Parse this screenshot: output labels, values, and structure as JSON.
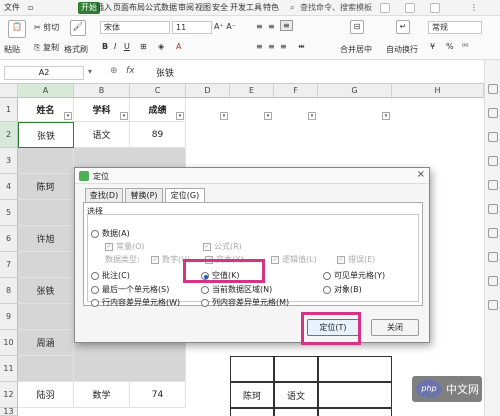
{
  "menu": {
    "file": "文件",
    "items": [
      "开始",
      "插入",
      "页面布局",
      "公式",
      "数据",
      "审阅",
      "视图",
      "安全",
      "开发工具",
      "特色"
    ],
    "search_placeholder": "查找命令、搜索模板"
  },
  "ribbon": {
    "paste": "粘贴",
    "cut": "剪切",
    "copy": "复制",
    "format_painter": "格式刷",
    "font_name": "宋体",
    "font_size": "11",
    "merge_center": "合并居中",
    "wrap_text": "自动换行",
    "number_format": "常规",
    "currency_symbol": "¥",
    "percent_symbol": "%"
  },
  "formula_bar": {
    "name_box": "A2",
    "fx": "fx",
    "value": "张铁"
  },
  "grid": {
    "columns": [
      "A",
      "B",
      "C",
      "D",
      "E",
      "F",
      "G",
      "H"
    ],
    "rows": [
      "1",
      "2",
      "3",
      "4",
      "5",
      "6",
      "7",
      "8",
      "9",
      "10",
      "11",
      "12",
      "13"
    ],
    "header": [
      "姓名",
      "学科",
      "成绩"
    ],
    "cells": {
      "a2": "张铁",
      "b2": "语文",
      "c2": "89",
      "a4": "陈珂",
      "a6": "许旭",
      "a8": "张铁",
      "a10": "周涵",
      "a12": "陆羽",
      "b12": "数学",
      "c12": "74",
      "e12": "陈珂",
      "f12": "语文"
    }
  },
  "dialog": {
    "title": "定位",
    "close": "×",
    "tabs": [
      "查找(D)",
      "替换(P)",
      "定位(G)"
    ],
    "group_label": "选择",
    "options": {
      "data": "数据(A)",
      "constants": "常量(O)",
      "formulas": "公式(R)",
      "data_type": "数据类型:",
      "numbers": "数字(U)",
      "text": "文本(X)",
      "logicals": "逻辑值(L)",
      "errors": "错误(E)",
      "comments": "批注(C)",
      "blanks": "空值(K)",
      "visible": "可见单元格(Y)",
      "last_cell": "最后一个单元格(S)",
      "current_array": "当前数据区域(N)",
      "objects": "对象(B)",
      "row_diff": "行内容差异单元格(W)",
      "col_diff": "列内容差异单元格(M)"
    },
    "locate_button": "定位(T)",
    "close_button": "关闭",
    "highlight_color": "#d63384"
  },
  "watermark": {
    "logo": "php",
    "text": "中文网"
  }
}
